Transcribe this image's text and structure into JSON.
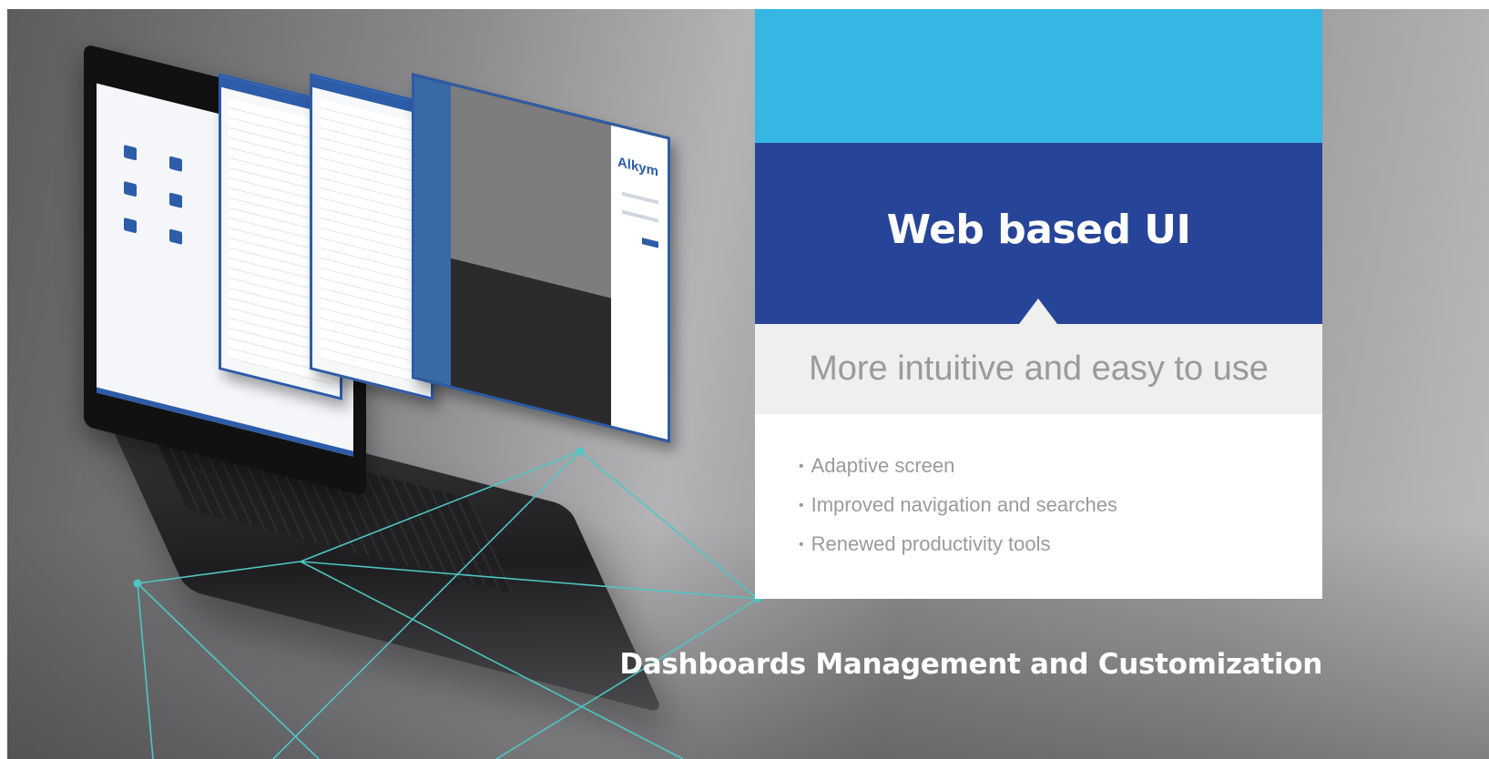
{
  "card": {
    "title": "Web based UI",
    "subtitle": "More intuitive and easy to use",
    "features": [
      "Adaptive screen",
      "Improved navigation and searches",
      "Renewed productivity tools"
    ]
  },
  "footer": {
    "title": "Dashboards Management and Customization"
  },
  "illustration": {
    "logo_text": "Alkym"
  },
  "colors": {
    "accent_light_blue": "#36b6e3",
    "accent_dark_blue": "#274598",
    "network_line": "#4fc6c4"
  }
}
